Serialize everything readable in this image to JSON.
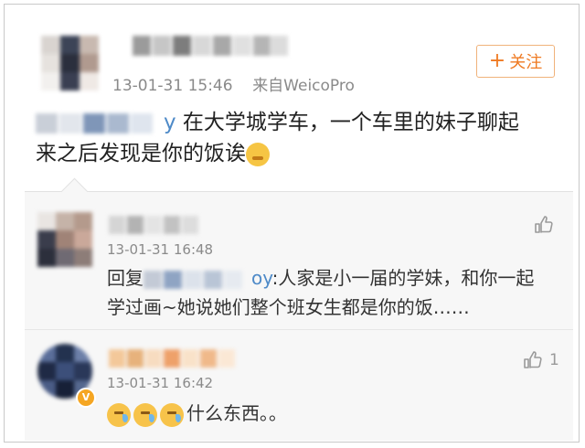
{
  "post": {
    "time": "13-01-31 15:46",
    "source": "来自WeicoPro",
    "follow_label": "关注",
    "follow_plus": "+",
    "mention_tail": "y",
    "text_line1": " 在大学城学车，一个车里的妹子聊起",
    "text_line2": "来之后发现是你的饭诶"
  },
  "comments": [
    {
      "time": "13-01-31 16:48",
      "reply_prefix": "回复",
      "reply_mention_tail": "oy",
      "text_line1": ":人家是小一届的学妹，和你一起",
      "text_line2": "学过画~她说她们整个班女生都是你的饭……",
      "likes": ""
    },
    {
      "time": "13-01-31 16:42",
      "text": "什么东西。。",
      "likes": "1"
    }
  ],
  "colors": {
    "accent": "#ef7a22",
    "link": "#4e8ac8",
    "meta": "#8a8a8a"
  }
}
